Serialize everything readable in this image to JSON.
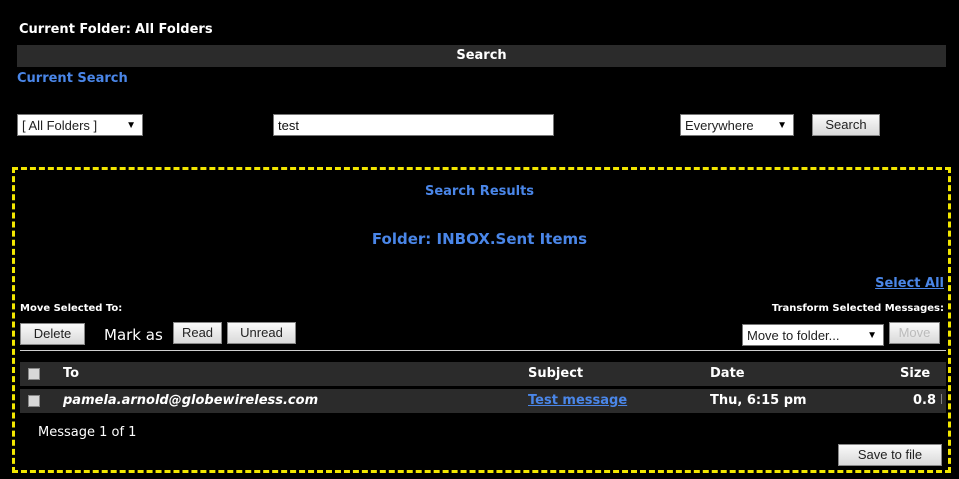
{
  "header": {
    "current_folder_label": "Current Folder:",
    "current_folder_value": "All Folders",
    "search_bar_title": "Search",
    "current_search_label": "Current Search"
  },
  "search": {
    "folder_select": "[ All Folders ]",
    "query": "test",
    "scope_select": "Everywhere",
    "search_button": "Search"
  },
  "results": {
    "title": "Search Results",
    "folder_title": "Folder: INBOX.Sent Items",
    "select_all": "Select All",
    "move_selected_label": "Move Selected To:",
    "transform_label": "Transform Selected Messages:",
    "delete_button": "Delete",
    "mark_as_label": "Mark as",
    "read_button": "Read",
    "unread_button": "Unread",
    "move_folder_select": "Move to folder...",
    "move_button": "Move",
    "columns": {
      "to": "To",
      "subject": "Subject",
      "date": "Date",
      "size": "Size"
    },
    "rows": [
      {
        "to": "pamela.arnold@globewireless.com",
        "subject": "Test message",
        "date": "Thu, 6:15 pm",
        "size": "0.8 k"
      }
    ],
    "count_text": "Message 1 of 1",
    "save_button": "Save to file"
  },
  "colors": {
    "accent": "#4a86e8",
    "highlight_border": "#f2e600",
    "background": "#000000"
  }
}
